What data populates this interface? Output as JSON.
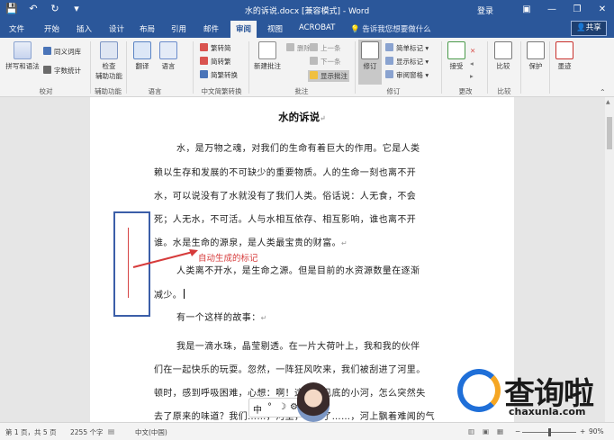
{
  "titlebar": {
    "title": "水的诉说.docx [兼容模式] - Word",
    "login": "登录",
    "quick_access": {
      "save_icon": "💾",
      "undo_icon": "↶",
      "repeat_icon": "↻",
      "customize_icon": "▾"
    },
    "window_buttons": {
      "ribbon_options": "▣",
      "minimize": "—",
      "restore": "❐",
      "close": "✕"
    }
  },
  "tabs": [
    "文件",
    "开始",
    "插入",
    "设计",
    "布局",
    "引用",
    "邮件",
    "审阅",
    "视图",
    "ACROBAT"
  ],
  "active_tab": "审阅",
  "tell_me": "告诉我您想要做什么",
  "share": "共享",
  "ribbon": {
    "proofing": {
      "spelling": "拼写和语法",
      "thesaurus": "同义词库",
      "word_count": "字数统计",
      "group": "校对"
    },
    "accessibility": {
      "check_line1": "检查",
      "check_line2": "辅助功能",
      "group": "辅助功能"
    },
    "language": {
      "translate": "翻译",
      "language": "语言",
      "group": "语言"
    },
    "chinese_conv": {
      "to_trad": "繁转简",
      "to_simp": "简转繁",
      "conv": "简繁转换",
      "group": "中文简繁转换"
    },
    "comments": {
      "new": "新建批注",
      "delete": "删除",
      "prev": "上一条",
      "next": "下一条",
      "show": "显示批注",
      "group": "批注"
    },
    "tracking": {
      "track": "修订",
      "markup": "简单标记",
      "show_markup": "显示标记",
      "pane": "审阅窗格",
      "group": "修订"
    },
    "changes": {
      "accept": "接受",
      "group": "更改"
    },
    "compare": {
      "compare": "比较",
      "group": "比较"
    },
    "protect": {
      "protect": "保护"
    },
    "ink": {
      "ink": "墨迹"
    }
  },
  "document": {
    "title": "水的诉说",
    "lines": [
      "水，是万物之魂，对我们的生命有着巨大的作用。它是人类",
      "赖以生存和发展的不可缺少的重要物质。人的生命一刻也离不开",
      "水，可以说没有了水就没有了我们人类。俗话说：人无食，不会",
      "死；人无水，不可活。人与水相互依存、相互影响，谁也离不开",
      "谁。水是生命的源泉，是人类最宝贵的财富。",
      "人类离不开水，是生命之源。但是目前的水资源数量在逐渐",
      "减少。",
      "有一个这样的故事：",
      "我是一滴水珠，晶莹剔透。在一片大荷叶上，我和我的伙伴",
      "们在一起快乐的玩耍。忽然，一阵狂风吹来，我们被刮进了河里。",
      "顿时，感到呼吸困难，心想：啊！这清澈见底的小河，怎么突然失",
      "去了原来的味道？我们……，河里，堆积了……，河上飘着难闻的气"
    ],
    "paragraph_mark": "↵",
    "annotation": "自动生成的标记"
  },
  "statusbar": {
    "page": "第 1 页，共 5 页",
    "words": "2255 个字",
    "lang": "中文(中国)",
    "zoom": "90%",
    "zoom_minus": "−",
    "zoom_plus": "+"
  },
  "ime": {
    "lang": "中",
    "punct": "°",
    "moon": "☽",
    "gear": "⚙"
  },
  "watermark": {
    "text": "查询啦",
    "url": "chaxunla.com"
  },
  "colors": {
    "accent": "#2b579a",
    "annotation": "#d63b3b",
    "box": "#3b5ea8"
  }
}
